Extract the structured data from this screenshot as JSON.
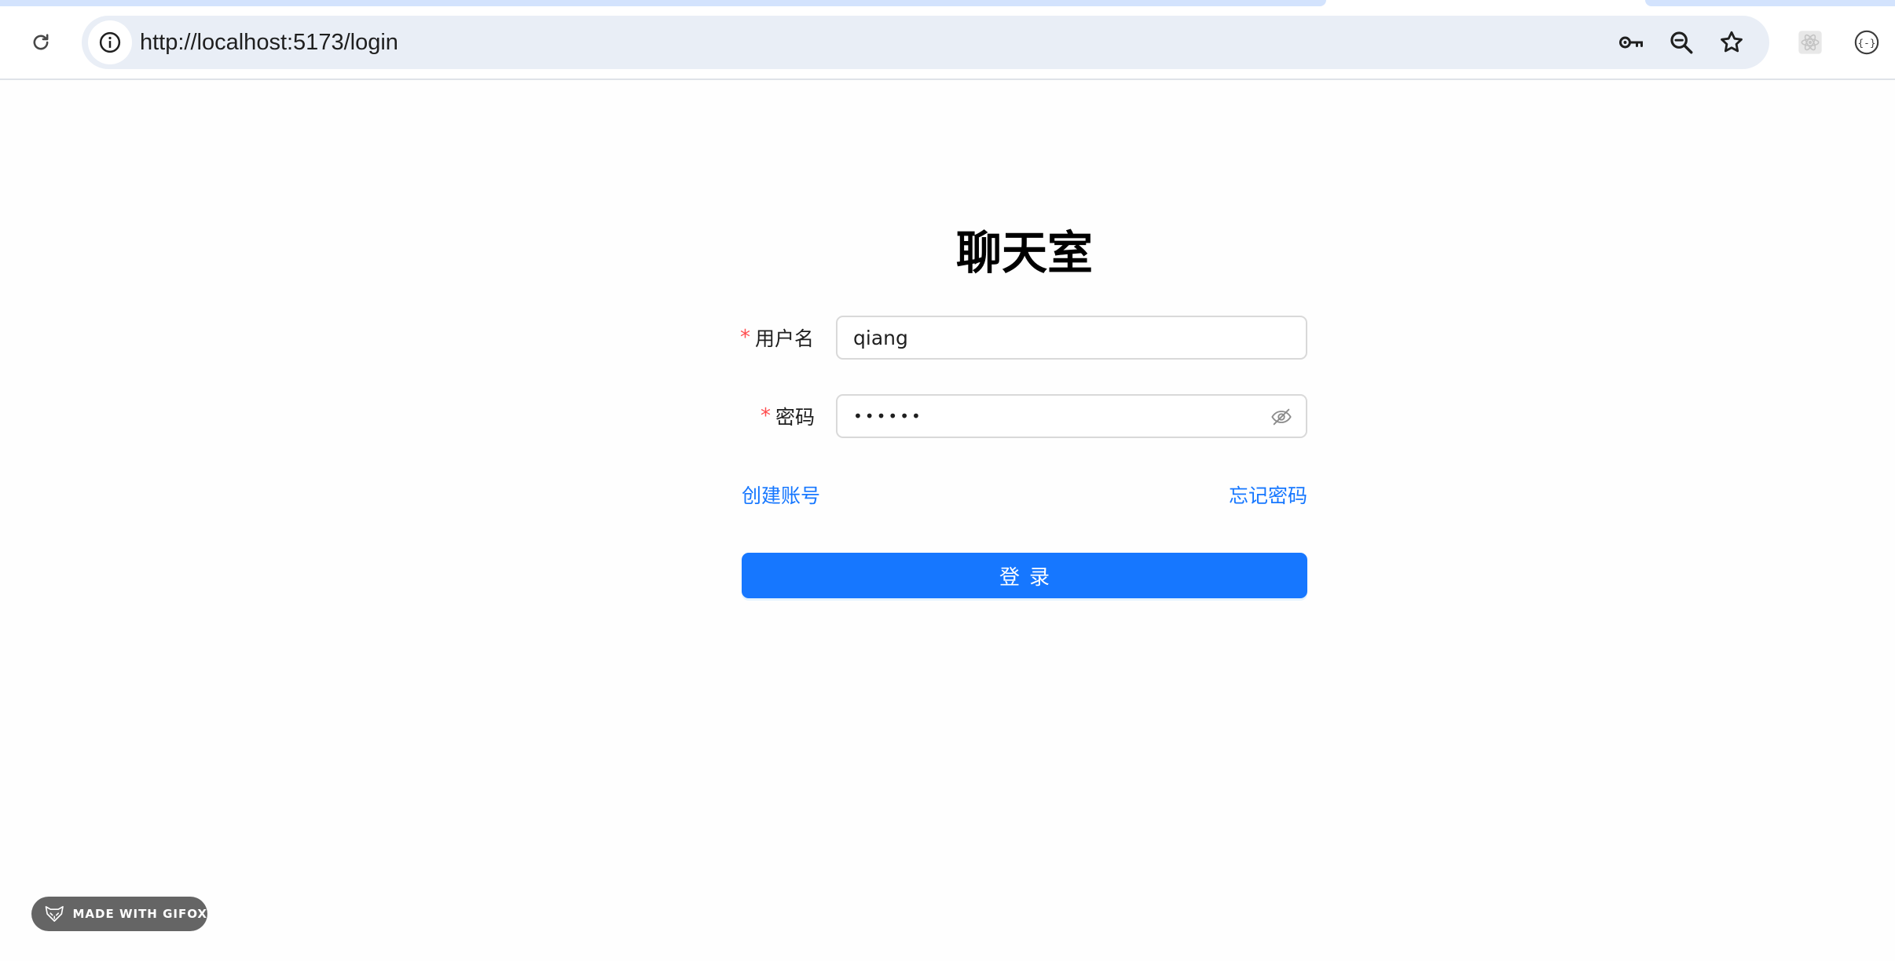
{
  "browser": {
    "url": "http://localhost:5173/login",
    "icons": {
      "reload": "reload-icon",
      "site_info": "info-icon",
      "password_manager": "key-icon",
      "zoom": "zoom-out-icon",
      "bookmark": "star-icon",
      "extension_1": "react-devtools-icon",
      "extension_2": "json-extension-icon"
    }
  },
  "login": {
    "title": "聊天室",
    "username": {
      "required_mark": "*",
      "label": "用户名",
      "value": "qiang"
    },
    "password": {
      "required_mark": "*",
      "label": "密码",
      "masked_value": "••••••",
      "toggle_icon": "eye-invisible-icon"
    },
    "create_account_link": "创建账号",
    "forgot_password_link": "忘记密码",
    "submit_label": "登录"
  },
  "watermark": {
    "text": "MADE WITH GIFOX",
    "icon": "fox-logo-icon"
  },
  "colors": {
    "primary": "#1677ff",
    "required": "#ff4d4f",
    "omnibox_bg": "#e9eef6",
    "badge_bg": "#656565"
  }
}
